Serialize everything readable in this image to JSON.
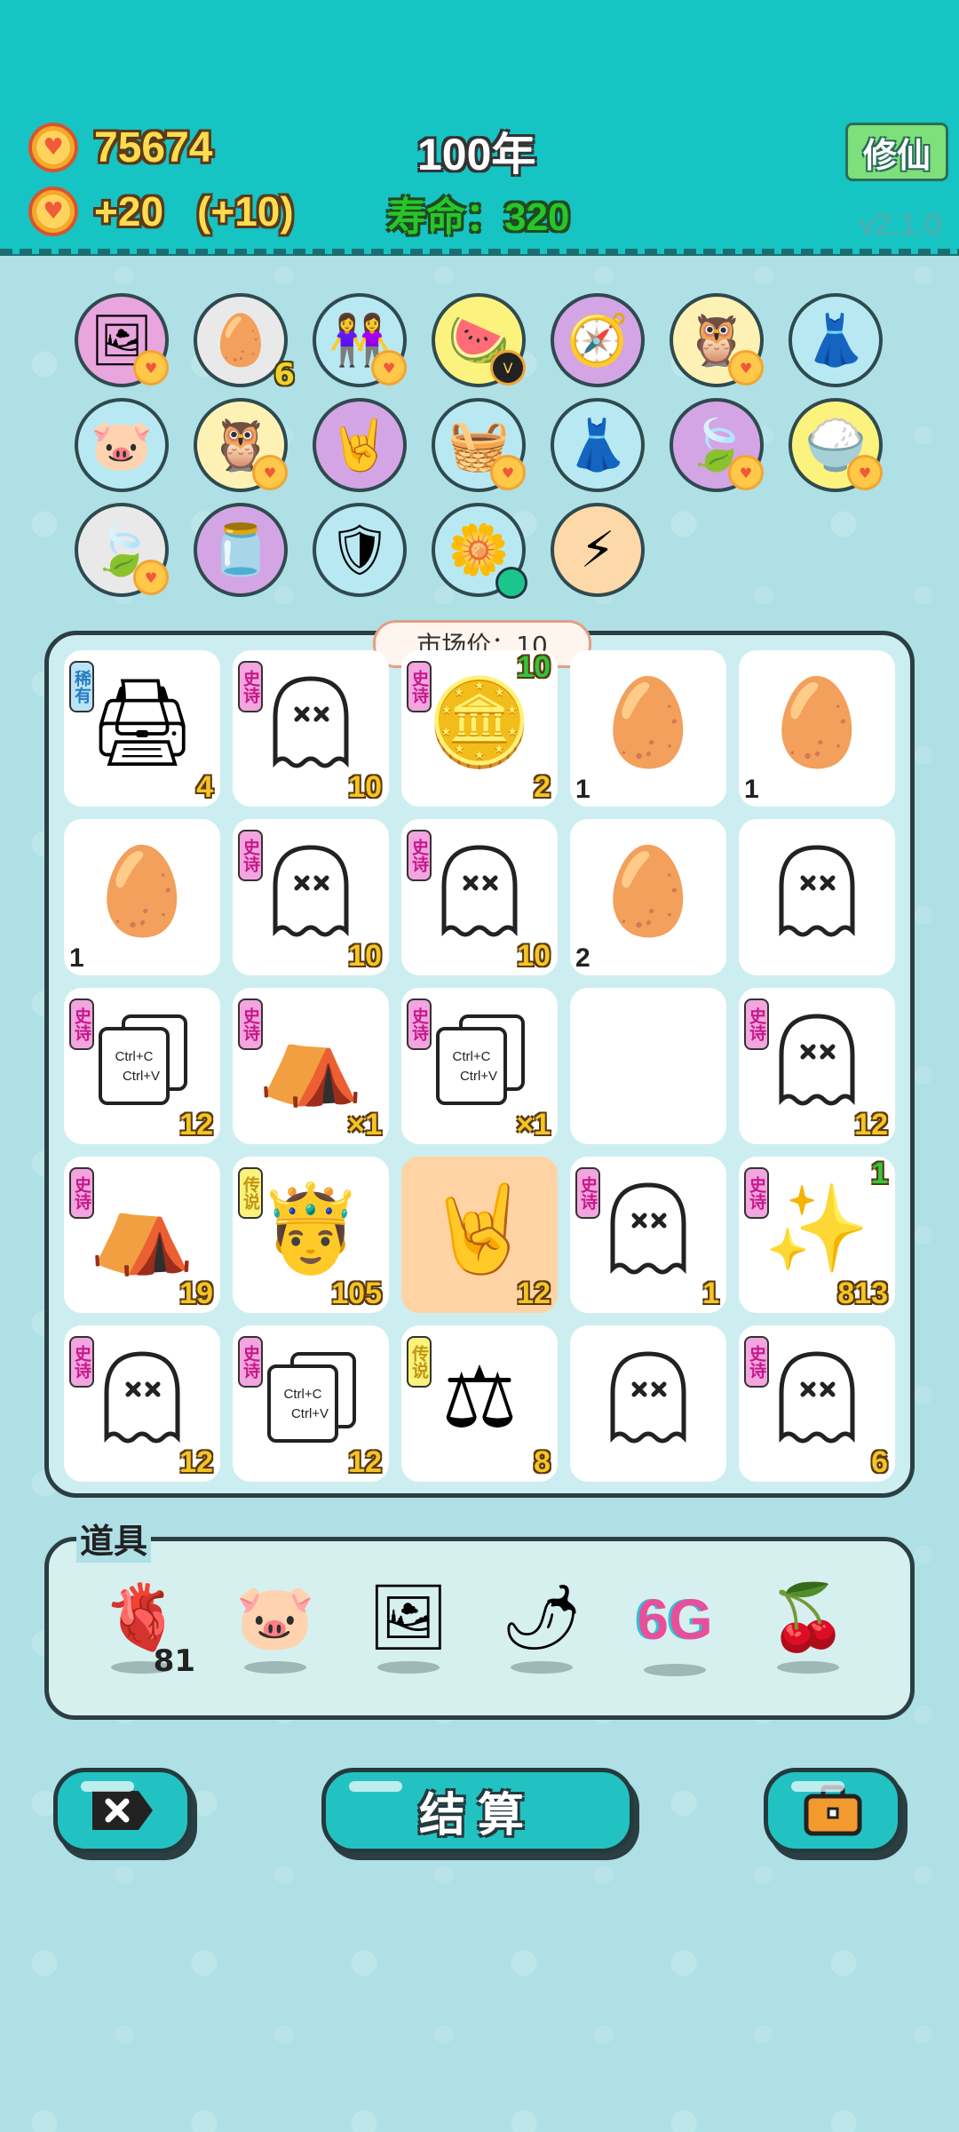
{
  "header": {
    "coins": "75674",
    "income": "+20",
    "income_bonus": "(+10)",
    "year": "100年",
    "lifespan_label": "寿命：",
    "lifespan_value": "320",
    "cultivate_button": "修仙",
    "version": "v2.1.0"
  },
  "relics": [
    {
      "icon": "portrait-frame-icon",
      "glyph": "🖼",
      "bg": "#e9a5dd",
      "badge": "heart-coin"
    },
    {
      "icon": "egg-carton-icon",
      "glyph": "🥚",
      "bg": "#e9e9e9",
      "sub": "6"
    },
    {
      "icon": "twins-icon",
      "glyph": "👭",
      "bg": "#b8e9f3",
      "badge": "heart-coin"
    },
    {
      "icon": "fruit-bowl-icon",
      "glyph": "🍉",
      "bg": "#fbf37e",
      "badge": "v-badge"
    },
    {
      "icon": "compass-icon",
      "glyph": "🧭",
      "bg": "#d3a5e5"
    },
    {
      "icon": "owl-icon",
      "glyph": "🦉",
      "bg": "#fdf2b4",
      "badge": "heart-coin"
    },
    {
      "icon": "pleated-skirt-icon",
      "glyph": "👗",
      "bg": "#b8e9f3"
    },
    {
      "icon": "piggy-bank-icon",
      "glyph": "🐷",
      "bg": "#b8e9f3"
    },
    {
      "icon": "owl-icon",
      "glyph": "🦉",
      "bg": "#fdf2b4",
      "badge": "heart-coin"
    },
    {
      "icon": "rock-hand-icon",
      "glyph": "🤘",
      "bg": "#d3a5e5"
    },
    {
      "icon": "fruit-basket-icon",
      "glyph": "🧺",
      "bg": "#b8e9f3",
      "badge": "heart-coin"
    },
    {
      "icon": "pleated-skirt-icon",
      "glyph": "👗",
      "bg": "#b8e9f3"
    },
    {
      "icon": "leaf-icon",
      "glyph": "🍃",
      "bg": "#d3a5e5",
      "badge": "heart-coin"
    },
    {
      "icon": "rice-bowl-icon",
      "glyph": "🍚",
      "bg": "#fbf37e",
      "badge": "heart-coin"
    },
    {
      "icon": "leaf-icon",
      "glyph": "🍃",
      "bg": "#e9e9e9",
      "badge": "heart-coin"
    },
    {
      "icon": "milk-jar-icon",
      "glyph": "🫙",
      "bg": "#d3a5e5"
    },
    {
      "icon": "shield-wrench-icon",
      "glyph": "🛡",
      "bg": "#b8e9f3"
    },
    {
      "icon": "potted-flower-icon",
      "glyph": "🌼",
      "bg": "#b8e9f3",
      "badge": "green-dot"
    },
    {
      "icon": "lightning-icon",
      "glyph": "⚡",
      "bg": "#fdd8a8"
    }
  ],
  "market_price": "市场价：10",
  "board": [
    {
      "icon": "printer-icon",
      "glyph": "🖨",
      "tag": "稀有",
      "tag_class": "xiyou",
      "count": "4"
    },
    {
      "icon": "ghost-icon",
      "glyph": "ghost",
      "tag": "史诗",
      "tag_class": "shishi",
      "count": "10"
    },
    {
      "icon": "coin-pie-icon",
      "glyph": "🪙",
      "tag": "史诗",
      "tag_class": "shishi",
      "count": "2",
      "extra": "10"
    },
    {
      "icon": "egg-icon",
      "glyph": "🥚",
      "count_left": "1"
    },
    {
      "icon": "egg-icon",
      "glyph": "🥚",
      "count_left": "1"
    },
    {
      "icon": "egg-icon",
      "glyph": "🥚",
      "count_left": "1"
    },
    {
      "icon": "ghost-icon",
      "glyph": "ghost",
      "tag": "史诗",
      "tag_class": "shishi",
      "count": "10"
    },
    {
      "icon": "ghost-icon",
      "glyph": "ghost",
      "tag": "史诗",
      "tag_class": "shishi",
      "count": "10"
    },
    {
      "icon": "egg-icon",
      "glyph": "🥚",
      "count_left": "2"
    },
    {
      "icon": "ghost-icon",
      "glyph": "ghost"
    },
    {
      "icon": "copy-paste-icon",
      "glyph": "copy",
      "tag": "史诗",
      "tag_class": "shishi",
      "count": "12"
    },
    {
      "icon": "bunny-tent-icon",
      "glyph": "⛺",
      "tag": "史诗",
      "tag_class": "shishi",
      "count": "×1"
    },
    {
      "icon": "copy-paste-icon",
      "glyph": "copy",
      "tag": "史诗",
      "tag_class": "shishi",
      "count": "×1"
    },
    {
      "icon": "empty-slot",
      "glyph": ""
    },
    {
      "icon": "ghost-icon",
      "glyph": "ghost",
      "tag": "史诗",
      "tag_class": "shishi",
      "count": "12"
    },
    {
      "icon": "bunny-tent-icon",
      "glyph": "⛺",
      "tag": "史诗",
      "tag_class": "shishi",
      "count": "19"
    },
    {
      "icon": "crowned-man-icon",
      "glyph": "🤴",
      "tag": "传说",
      "tag_class": "chuanshuo",
      "count": "105"
    },
    {
      "icon": "rock-hand-icon",
      "glyph": "🤘",
      "count": "12",
      "highlight": true
    },
    {
      "icon": "ghost-icon",
      "glyph": "ghost",
      "tag": "史诗",
      "tag_class": "shishi",
      "count": "1"
    },
    {
      "icon": "sparkle-coins-icon",
      "glyph": "✨",
      "tag": "史诗",
      "tag_class": "shishi",
      "count": "813",
      "extra": "1"
    },
    {
      "icon": "ghost-icon",
      "glyph": "ghost",
      "tag": "史诗",
      "tag_class": "shishi",
      "count": "12"
    },
    {
      "icon": "copy-paste-icon",
      "glyph": "copy",
      "tag": "史诗",
      "tag_class": "shishi",
      "count": "12"
    },
    {
      "icon": "balance-scale-icon",
      "glyph": "⚖",
      "tag": "传说",
      "tag_class": "chuanshuo",
      "count": "8"
    },
    {
      "icon": "ghost-icon",
      "glyph": "ghost"
    },
    {
      "icon": "ghost-icon",
      "glyph": "ghost",
      "tag": "史诗",
      "tag_class": "shishi",
      "count": "6"
    }
  ],
  "copy_paste_text": [
    "Ctrl+C",
    "Ctrl+V"
  ],
  "items_title": "道具",
  "items": [
    {
      "icon": "liver-icon",
      "glyph": "🫀",
      "count": "81"
    },
    {
      "icon": "piggy-bank-icon",
      "glyph": "🐷"
    },
    {
      "icon": "picture-frame-icon",
      "glyph": "🖼"
    },
    {
      "icon": "chili-pepper-icon",
      "glyph": "🌶"
    },
    {
      "icon": "6g-icon",
      "glyph": "6G"
    },
    {
      "icon": "lychee-icon",
      "glyph": "🍒"
    }
  ],
  "bottom": {
    "settle_label": "结算"
  }
}
